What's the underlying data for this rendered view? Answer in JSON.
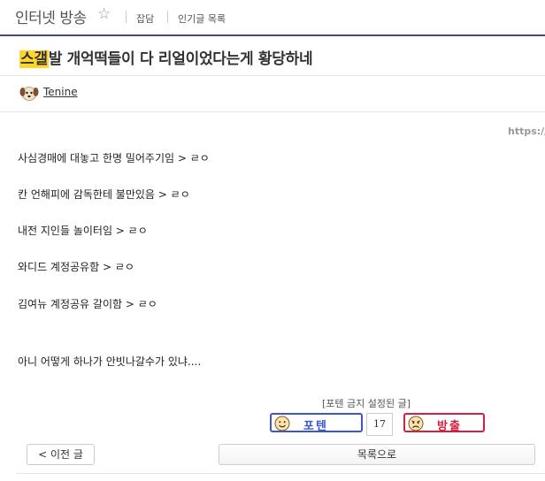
{
  "header": {
    "gallery_name": "인터넷 방송",
    "star_icon": "star-outline-icon",
    "links": [
      "잡담",
      "인기글 목록"
    ]
  },
  "post": {
    "title_highlight": "스갤",
    "title_rest": "발 개억떡들이 다 리얼이었다는게 황당하네",
    "author": "Tenine",
    "url_fragment": "https://",
    "lines": [
      "사심경매에 대놓고 한명 밀어주기임 > ㄹㅇ",
      "칸 언해피에 감독한테 불만있음 > ㄹㅇ",
      "내전 지인들 놀이터임 > ㄹㅇ",
      "와디드 계정공유함 > ㄹㅇ",
      "김여뉴 계정공유 갈이함 > ㄹㅇ",
      "아니 어떻게 하나가 안빗나갈수가 있냐...."
    ]
  },
  "vote": {
    "notice": "[포텐 금지 설정된 글]",
    "up_label": "포텐",
    "count": "17",
    "down_label": "방출",
    "up_color": "#3b57c8",
    "down_color": "#d3203e"
  },
  "nav": {
    "prev_label": "< 이전 글",
    "list_label": "목록으로"
  }
}
